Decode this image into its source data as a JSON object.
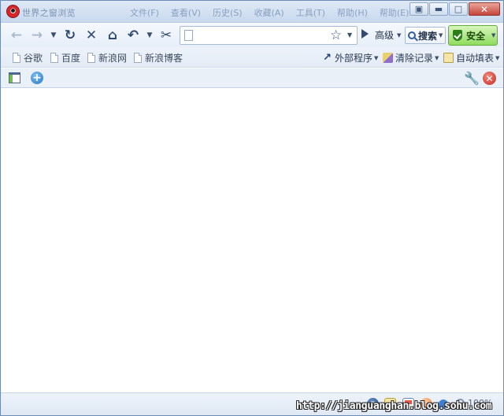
{
  "titlebar": {
    "app_title": "世界之窗浏览",
    "menus": [
      "文件(F)",
      "查看(V)",
      "历史(S)",
      "收藏(A)",
      "工具(T)",
      "帮助(H)",
      "帮助(E)"
    ],
    "window_buttons": {
      "box": "▣",
      "minimize": "▬",
      "maximize": "□",
      "close": "✕"
    }
  },
  "navbar": {
    "back_icon": "←",
    "forward_icon": "→",
    "dropdown_icon": "▼",
    "refresh_icon": "↻",
    "stop_icon": "✕",
    "home_icon": "⌂",
    "undo_icon": "↶",
    "cut_icon": "✂",
    "address": {
      "value": "",
      "placeholder": ""
    },
    "star_icon": "☆",
    "advanced_label": "高级",
    "search_label": "搜索",
    "safe_label": "安全"
  },
  "favorites": {
    "items": [
      {
        "label": "谷歌"
      },
      {
        "label": "百度"
      },
      {
        "label": "新浪网"
      },
      {
        "label": "新浪博客"
      }
    ],
    "tools": {
      "external_label": "外部程序",
      "clear_label": "清除记录",
      "autofill_label": "自动填表"
    }
  },
  "toolrow": {
    "plus_icon": "+",
    "wrench_icon": "🔧",
    "close_icon": "✕"
  },
  "status": {
    "a_icon": "a",
    "zoom": "100%",
    "watermark": "http://jianguanghan.blog.sohu.com"
  }
}
